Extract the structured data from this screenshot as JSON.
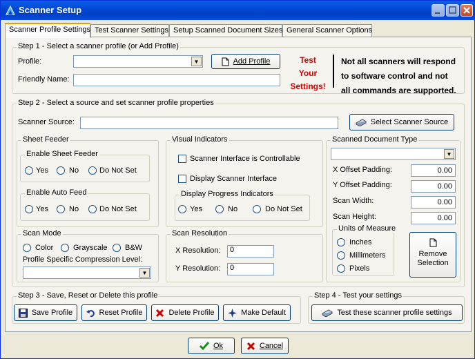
{
  "window": {
    "title": "Scanner Setup"
  },
  "tabs": [
    {
      "label": "Scanner Profile Settings"
    },
    {
      "label": "Test Scanner Settings"
    },
    {
      "label": "Setup Scanned Document Sizes"
    },
    {
      "label": "General Scanner Options"
    }
  ],
  "step1": {
    "title": "Step 1 - Select a scanner profile (or Add Profile)",
    "profile_label": "Profile:",
    "profile_value": "",
    "friendly_label": "Friendly Name:",
    "friendly_value": "",
    "add_button": "Add Profile",
    "test_line1": "Test",
    "test_line2": "Your",
    "test_line3": "Settings!",
    "note_line1": "Not all scanners will respond",
    "note_line2": "to software control and not",
    "note_line3": "all commands are supported."
  },
  "step2": {
    "title": "Step 2 - Select a source and set scanner profile properties",
    "source_label": "Scanner Source:",
    "source_value": "",
    "select_source_button": "Select Scanner Source",
    "sheet_feeder": {
      "title": "Sheet Feeder",
      "enable_title": "Enable Sheet Feeder",
      "auto_title": "Enable Auto Feed",
      "opt_yes": "Yes",
      "opt_no": "No",
      "opt_dns": "Do Not Set"
    },
    "visual": {
      "title": "Visual Indicators",
      "chk1": "Scanner Interface is Controllable",
      "chk2": "Display Scanner Interface",
      "progress_title": "Display Progress Indicators",
      "opt_yes": "Yes",
      "opt_no": "No",
      "opt_dns": "Do Not Set"
    },
    "doc_type": {
      "title": "Scanned Document Type",
      "value": "",
      "x_offset_label": "X Offset Padding:",
      "x_offset": "0.00",
      "y_offset_label": "Y Offset Padding:",
      "y_offset": "0.00",
      "width_label": "Scan Width:",
      "width": "0.00",
      "height_label": "Scan Height:",
      "height": "0.00",
      "units_title": "Units of Measure",
      "u_inches": "Inches",
      "u_mm": "Millimeters",
      "u_px": "Pixels",
      "remove_line1": "Remove",
      "remove_line2": "Selection"
    },
    "scan_mode": {
      "title": "Scan Mode",
      "opt_color": "Color",
      "opt_gray": "Grayscale",
      "opt_bw": "B&W",
      "compression_label": "Profile Specific Compression Level:",
      "compression_value": ""
    },
    "resolution": {
      "title": "Scan Resolution",
      "x_label": "X Resolution:",
      "x_value": "0",
      "y_label": "Y Resolution:",
      "y_value": "0"
    }
  },
  "step3": {
    "title": "Step 3 - Save, Reset or Delete this profile",
    "save": "Save Profile",
    "reset": "Reset Profile",
    "delete": "Delete Profile",
    "default": "Make Default"
  },
  "step4": {
    "title": "Step 4 - Test your settings",
    "test_button": "Test these scanner profile settings"
  },
  "footer": {
    "ok": "Ok",
    "cancel": "Cancel"
  },
  "colors": {
    "accent": "#d40000",
    "titlebar": "#0348d4"
  }
}
